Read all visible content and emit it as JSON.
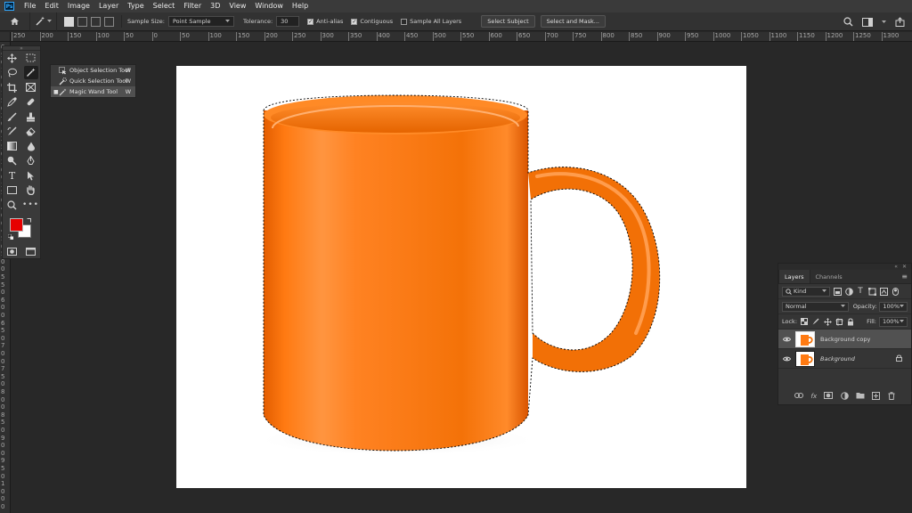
{
  "app": {
    "logo_text": "Ps"
  },
  "menu": [
    "File",
    "Edit",
    "Image",
    "Layer",
    "Type",
    "Select",
    "Filter",
    "3D",
    "View",
    "Window",
    "Help"
  ],
  "options": {
    "sample_size_label": "Sample Size:",
    "sample_size_value": "Point Sample",
    "tolerance_label": "Tolerance:",
    "tolerance_value": "30",
    "anti_alias_label": "Anti-alias",
    "contiguous_label": "Contiguous",
    "sample_all_layers_label": "Sample All Layers",
    "select_subject_label": "Select Subject",
    "select_and_mask_label": "Select and Mask..."
  },
  "ruler": {
    "top": [
      "250",
      "200",
      "150",
      "100",
      "50",
      "0",
      "50",
      "100",
      "150",
      "200",
      "250",
      "300",
      "350",
      "400",
      "450",
      "500",
      "550",
      "600",
      "650",
      "700",
      "750",
      "800",
      "850",
      "900",
      "950",
      "1000",
      "1050",
      "1100",
      "1150",
      "1200",
      "1250",
      "1300"
    ],
    "left": [
      "0",
      "5",
      "0",
      "1",
      "0",
      "0",
      "1",
      "5",
      "0",
      "2",
      "0",
      "0",
      "2",
      "5",
      "0",
      "3",
      "0",
      "0",
      "3",
      "5",
      "0",
      "4",
      "0",
      "0",
      "4",
      "5",
      "0",
      "5",
      "0",
      "0",
      "5",
      "5",
      "0",
      "6",
      "0",
      "0",
      "6",
      "5",
      "0",
      "7",
      "0",
      "0",
      "7",
      "5",
      "0",
      "8",
      "0",
      "0",
      "8",
      "5",
      "0",
      "9",
      "0",
      "0",
      "9",
      "5",
      "0",
      "1",
      "0",
      "0",
      "0"
    ]
  },
  "flyout": {
    "items": [
      {
        "label": "Object Selection Tool",
        "shortcut": "W"
      },
      {
        "label": "Quick Selection Tool",
        "shortcut": "W"
      },
      {
        "label": "Magic Wand Tool",
        "shortcut": "W"
      }
    ]
  },
  "colors": {
    "foreground": "#e60000",
    "background": "#ffffff",
    "mug": "#ff7a12",
    "accent": "#31a8ff"
  },
  "layers_panel": {
    "tab_layers": "Layers",
    "tab_channels": "Channels",
    "filter_kind": "Kind",
    "blend_mode": "Normal",
    "opacity_label": "Opacity:",
    "opacity_value": "100%",
    "lock_label": "Lock:",
    "fill_label": "Fill:",
    "fill_value": "100%",
    "layers": [
      {
        "name": "Background copy",
        "selected": true,
        "italic": false,
        "locked": false
      },
      {
        "name": "Background",
        "selected": false,
        "italic": true,
        "locked": true
      }
    ],
    "footer_fx": "fx"
  }
}
